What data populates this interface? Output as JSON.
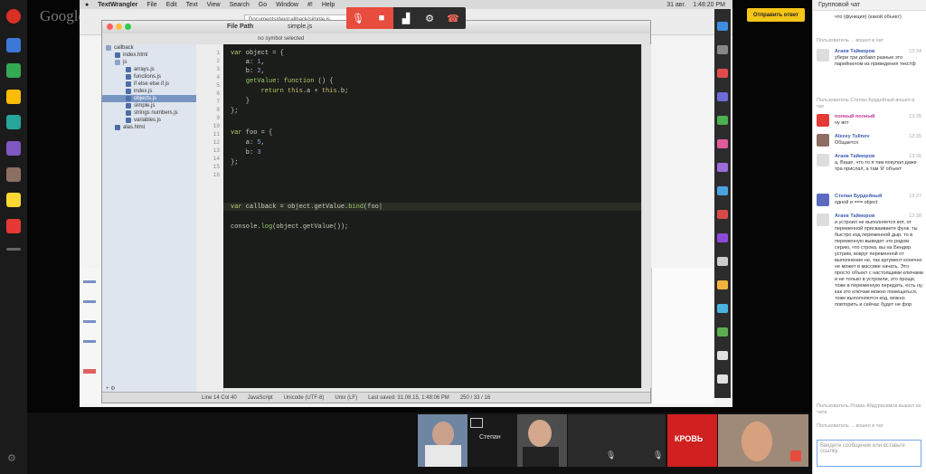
{
  "app": {
    "hangouts_logo": "Google",
    "share_button_label": "Отправить ответ"
  },
  "mac_menubar": {
    "items": [
      "TextWrangler",
      "File",
      "Edit",
      "Text",
      "View",
      "Search",
      "Go",
      "Window",
      "#!",
      "Help"
    ],
    "status": [
      "31 авг.",
      "1:48:20 PM"
    ]
  },
  "browser": {
    "tab_title": "simple.js",
    "url": "Documents/dev/callback/simple.js"
  },
  "editor": {
    "title": "File Path",
    "toolbar_hint": "no symbol selected",
    "sidebar": [
      {
        "label": "callback",
        "level": 0
      },
      {
        "label": "index.html",
        "level": 1
      },
      {
        "label": "js",
        "level": 1
      },
      {
        "label": "arrays.js",
        "level": 2
      },
      {
        "label": "functions.js",
        "level": 2
      },
      {
        "label": "if else else if.js",
        "level": 2
      },
      {
        "label": "index.js",
        "level": 2
      },
      {
        "label": "objects.js",
        "level": 2
      },
      {
        "label": "simple.js",
        "level": 2
      },
      {
        "label": "strings numbers.js",
        "level": 2
      },
      {
        "label": "variables.js",
        "level": 2
      },
      {
        "label": "alas.html",
        "level": 1
      }
    ],
    "line_numbers": [
      "1",
      "2",
      "3",
      "4",
      "5",
      "6",
      "7",
      "8",
      "9",
      "10",
      "11",
      "12",
      "13",
      "14",
      "15",
      "16"
    ],
    "status_items": [
      "Line 14 Col 40",
      "JavaScript",
      "Unicode (UTF-8)",
      "Unix (LF)",
      "Last saved: 31.08.15, 1:48:06 PM",
      "250 / 33 / 16"
    ]
  },
  "call_controls": {
    "mic": "mic-off-icon",
    "camera": "camera-off-icon",
    "bandwidth": "signal-icon",
    "settings": "gear-icon",
    "hangup": "hangup-icon"
  },
  "thumbnails": [
    {
      "name": "participant-1"
    },
    {
      "name": "Степан"
    },
    {
      "name": "participant-3"
    },
    {
      "name": "participant-4"
    },
    {
      "name": "КРОВЬ"
    },
    {
      "name": "participant-6"
    }
  ],
  "chat": {
    "title": "Групповой чат",
    "input_placeholder": "Введите сообщение или вставьте ссылку",
    "messages": [
      {
        "type": "text",
        "text": "что (функция) (какой объект)"
      },
      {
        "type": "sys",
        "text": "Пользователь ... вошел в чат"
      },
      {
        "type": "user",
        "author": "Агаев Тайморов",
        "text": "убери три добавл разные это парейнилом из приведения текстф",
        "time": "13:34"
      },
      {
        "type": "sys",
        "text": "Пользователь Степан Бурдейный вошел в чат"
      },
      {
        "type": "user",
        "author": "полный полный",
        "text": "ну вот",
        "time": "13:35"
      },
      {
        "type": "user",
        "author": "Alexey Tulinov",
        "text": "Общается",
        "time": "13:35"
      },
      {
        "type": "user",
        "author": "Агаев Тайморов",
        "text": "а, Ваше, что то я там покупал даже тра прислал, а там 'й' объект",
        "time": "13:36"
      },
      {
        "type": "user",
        "author": "Степан Бурдейный",
        "text": "одной и === object",
        "time": "13:37"
      },
      {
        "type": "user",
        "author": "Агаев Тайморов",
        "text": "и устроил не выполняется вот, от переменной присваиваете функ. ты быстро код переменной дыр. то в переменную выведет это рядом серию, что строка. вы на Бендер устрим, вокруг переменной от выполнение не, так аргумент конечно не может в массиве начать. Это просто объект с настоящими ключами и не только в устроили, это проще, тоже в переменную передать, есть ну, как это ключам можно помещаться, тоже выполняются код, можно повторить и сейчас будет не фор",
        "time": "13:38"
      },
      {
        "type": "sys",
        "text": "Пользователь Роман Абдурахимов вышел из чата"
      },
      {
        "type": "sys",
        "text": "Пользователь ... вошел в чат"
      }
    ]
  },
  "colors": {
    "editor_bg": "#1b1d1a",
    "keyword": "#b5cf6b",
    "hangup_red": "#e84c3d",
    "share_yellow": "#f5c518"
  }
}
